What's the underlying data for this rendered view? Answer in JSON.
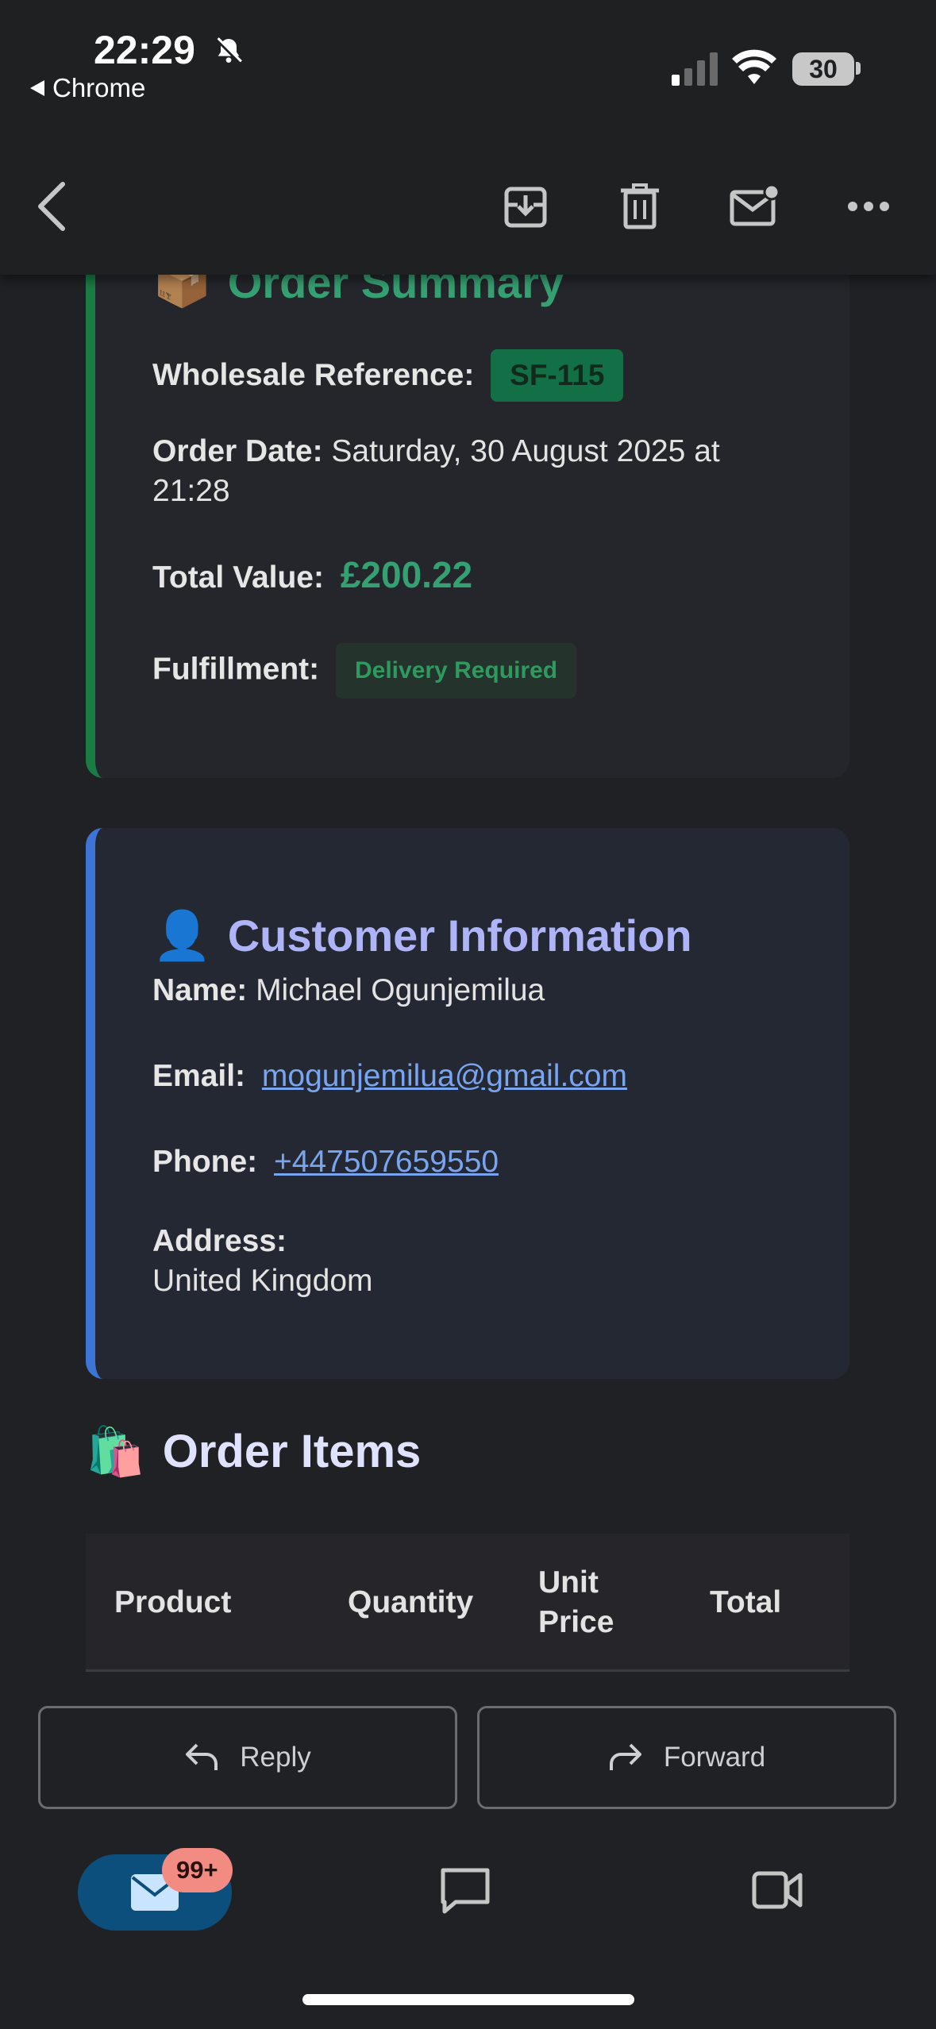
{
  "status_bar": {
    "time": "22:29",
    "back_app": "Chrome",
    "battery": "30",
    "icons": [
      "bell-off-icon",
      "signal-icon",
      "wifi-icon",
      "battery-icon"
    ]
  },
  "toolbar": {
    "icons": [
      "back-arrow-icon",
      "archive-icon",
      "trash-icon",
      "mark-unread-icon",
      "more-options-icon"
    ]
  },
  "order_summary": {
    "emoji": "📦",
    "title": "Order Summary",
    "wholesale_label": "Wholesale Reference:",
    "wholesale_value": "SF-115",
    "date_label": "Order Date:",
    "date_value_line1": "Saturday, 30 August 2025 at",
    "date_value_line2": "21:28",
    "total_label": "Total Value:",
    "total_value": "£200.22",
    "fulfillment_label": "Fulfillment:",
    "fulfillment_value": "Delivery Required"
  },
  "customer": {
    "emoji": "👤",
    "title": "Customer Information",
    "name_label": "Name:",
    "name_value": "Michael Ogunjemilua",
    "email_label": "Email:",
    "email_value": "mogunjemilua@gmail.com",
    "phone_label": "Phone:",
    "phone_value": "+447507659550",
    "address_label": "Address:",
    "address_value": "United Kingdom"
  },
  "order_items": {
    "emoji": "🛍️",
    "title": "Order Items",
    "columns": [
      "Product",
      "Quantity",
      "Unit Price",
      "Total"
    ]
  },
  "actions": {
    "reply_label": "Reply",
    "forward_label": "Forward"
  },
  "bottom_nav": {
    "mail_badge": "99+",
    "items": [
      "mail-icon",
      "chat-icon",
      "meet-video-icon"
    ]
  },
  "colors": {
    "background": "#202124",
    "summary_accent": "#1b7b45",
    "summary_title": "#35a172",
    "customer_accent": "#3d74d6",
    "customer_title": "#aeb4f7",
    "link": "#79a4f0",
    "badge": "#f28b82",
    "mail_pill": "#0d4f7c"
  }
}
